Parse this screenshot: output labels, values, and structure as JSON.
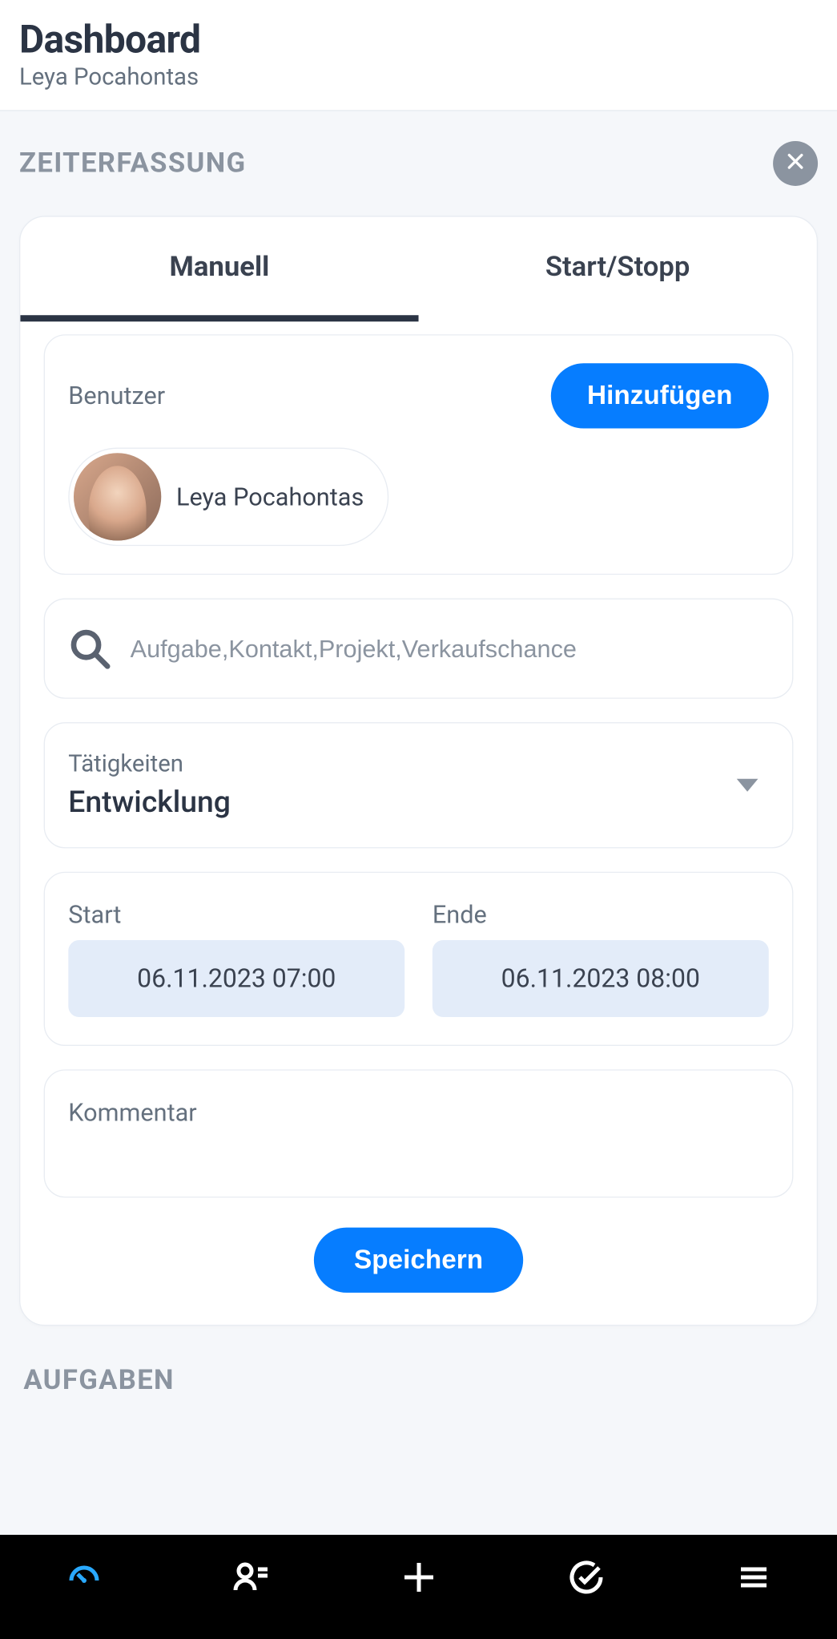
{
  "header": {
    "title": "Dashboard",
    "subtitle": "Leya Pocahontas"
  },
  "section": {
    "title": "ZEITERFASSUNG"
  },
  "tabs": {
    "manual": "Manuell",
    "startstop": "Start/Stopp"
  },
  "user": {
    "label": "Benutzer",
    "add_button": "Hinzufügen",
    "chip_name": "Leya Pocahontas"
  },
  "search": {
    "placeholder": "Aufgabe,Kontakt,Projekt,Verkaufschance"
  },
  "activity": {
    "label": "Tätigkeiten",
    "value": "Entwicklung"
  },
  "time": {
    "start_label": "Start",
    "start_value": "06.11.2023 07:00",
    "end_label": "Ende",
    "end_value": "06.11.2023 08:00"
  },
  "comment": {
    "label": "Kommentar"
  },
  "save_button": "Speichern",
  "tasks_section": "AUFGABEN"
}
